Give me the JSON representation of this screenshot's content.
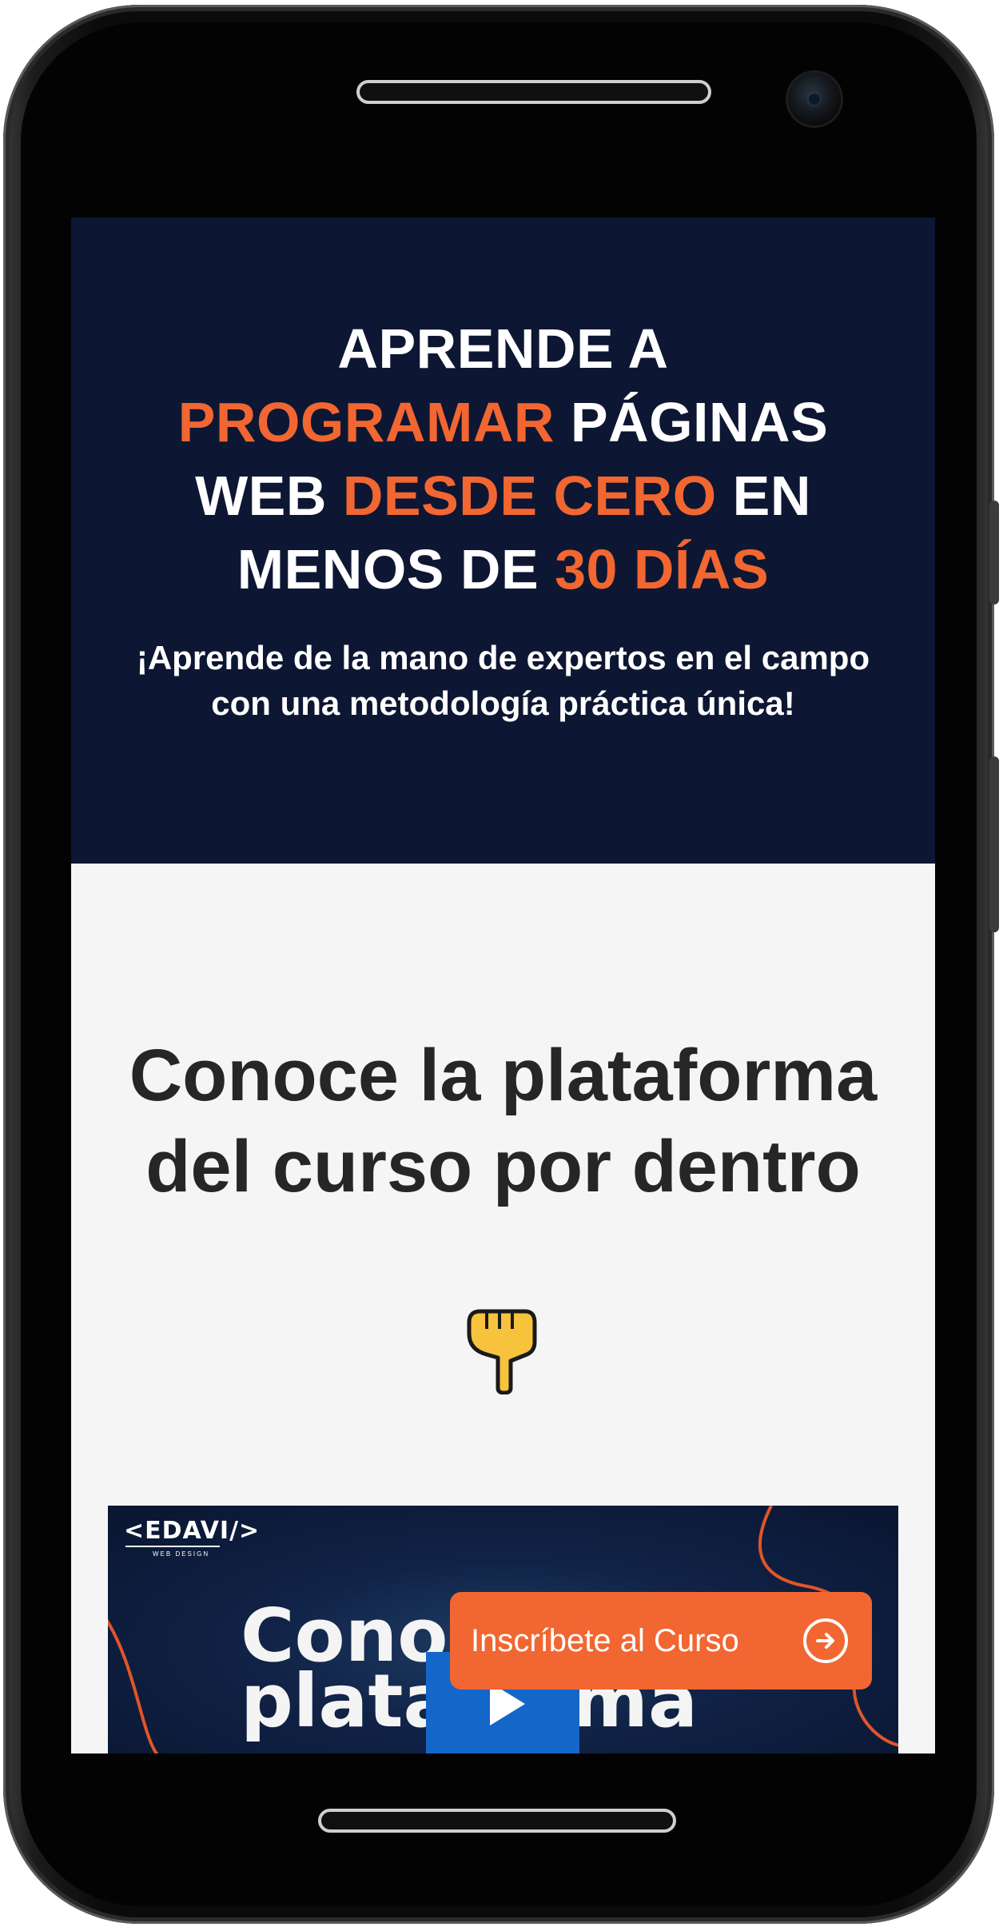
{
  "hero": {
    "title_line1": "APRENDE A",
    "title_line2_hl": "PROGRAMAR",
    "title_line2_rest": " PÁGINAS",
    "title_line3_start": "WEB ",
    "title_line3_hl": "DESDE CERO",
    "title_line3_rest": " EN",
    "title_line4_start": "MENOS DE ",
    "title_line4_hl": "30 DÍAS",
    "subtitle": "¡Aprende de la mano de expertos en el campo con una metodología práctica única!"
  },
  "section": {
    "title": "Conoce la plataforma del curso por dentro",
    "icon": "pointing-down-hand-icon"
  },
  "video": {
    "logo": "<EDAVI/>",
    "logo_sub": "WEB DESIGN",
    "text_line1": "Conoce la",
    "text_line2": "plataforma",
    "play_icon": "play-icon"
  },
  "cta": {
    "label": "Inscríbete al Curso",
    "icon": "arrow-circle-right-icon"
  },
  "colors": {
    "hero_bg": "#0d1733",
    "accent": "#f26631",
    "section_bg": "#f5f5f5",
    "play_button": "#1467c9"
  }
}
